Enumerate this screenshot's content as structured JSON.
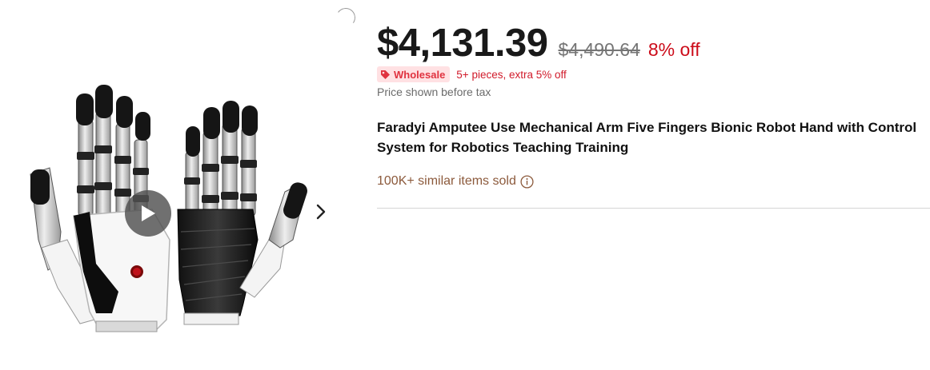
{
  "gallery": {
    "image_alt": "Bionic robot hand product photo",
    "icons": {
      "play": "play-icon",
      "next": "chevron-right-icon"
    }
  },
  "price": {
    "current": "$4,131.39",
    "original": "$4,490.64",
    "discount": "8% off",
    "colors": {
      "discount": "#cc0c1a",
      "original": "#757575"
    }
  },
  "wholesale": {
    "badge_label": "Wholesale",
    "note": "5+ pieces, extra 5% off",
    "icon": "tag-icon",
    "colors": {
      "badge_bg": "#ffe1e3",
      "badge_text": "#e0323f"
    }
  },
  "tax_note": "Price shown before tax",
  "product_title": "Faradyi Amputee Use Mechanical Arm Five Fingers Bionic Robot Hand with Control System for Robotics Teaching Training",
  "sales": {
    "text": "100K+ similar items sold",
    "icon": "info-icon",
    "color": "#8c5a3c"
  }
}
